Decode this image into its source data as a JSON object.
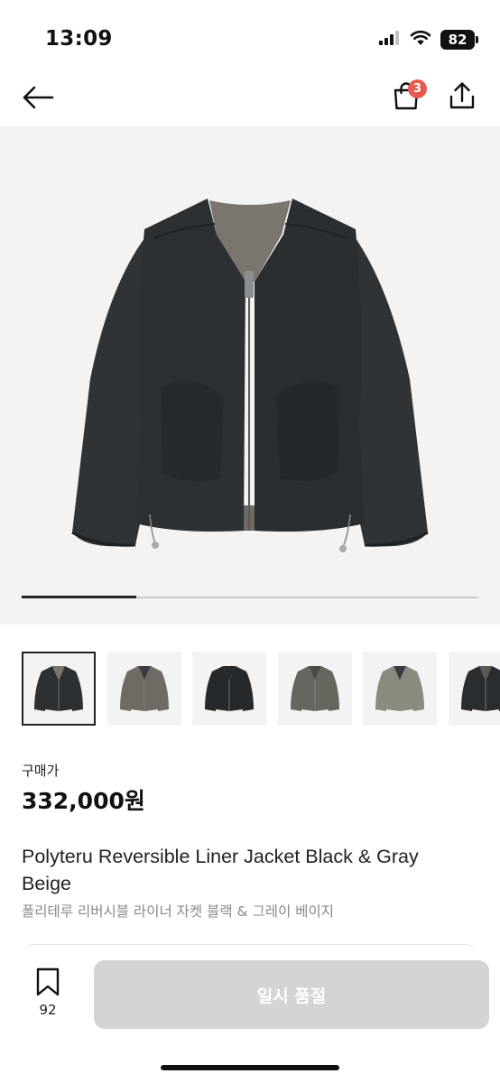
{
  "status_bar": {
    "time": "13:09",
    "battery": "82",
    "icons": [
      "signal-icon",
      "wifi-icon",
      "battery-icon"
    ]
  },
  "nav": {
    "back_icon": "arrow-left-icon",
    "bag_icon": "shopping-bag-icon",
    "bag_badge": "3",
    "share_icon": "share-icon"
  },
  "hero": {
    "image": "black-reversible-liner-jacket",
    "image_index": 1,
    "image_count": 6,
    "progress": 0.25
  },
  "thumbnails": [
    {
      "variant": "black",
      "selected": true
    },
    {
      "variant": "gray-beige",
      "selected": false
    },
    {
      "variant": "black-flat",
      "selected": false
    },
    {
      "variant": "gray-beige-flat",
      "selected": false
    },
    {
      "variant": "gray-beige-inside",
      "selected": false
    },
    {
      "variant": "black-folded",
      "selected": false
    }
  ],
  "price": {
    "label": "구매가",
    "value": "332,000원"
  },
  "product": {
    "title": "Polyteru Reversible Liner Jacket Black & Gray Beige",
    "subtitle": "폴리테루 리버시블 라이너 자켓 블랙 & 그레이 베이지"
  },
  "bottom_bar": {
    "bookmark_icon": "bookmark-icon",
    "bookmark_count": "92",
    "button_label": "일시 품절"
  },
  "colors": {
    "badge": "#e85a4f",
    "disabled_button": "#d4d4d4",
    "jacket_black": "#2c3033",
    "jacket_gray": "#6f6b63",
    "image_background": "#f3f3f3"
  }
}
